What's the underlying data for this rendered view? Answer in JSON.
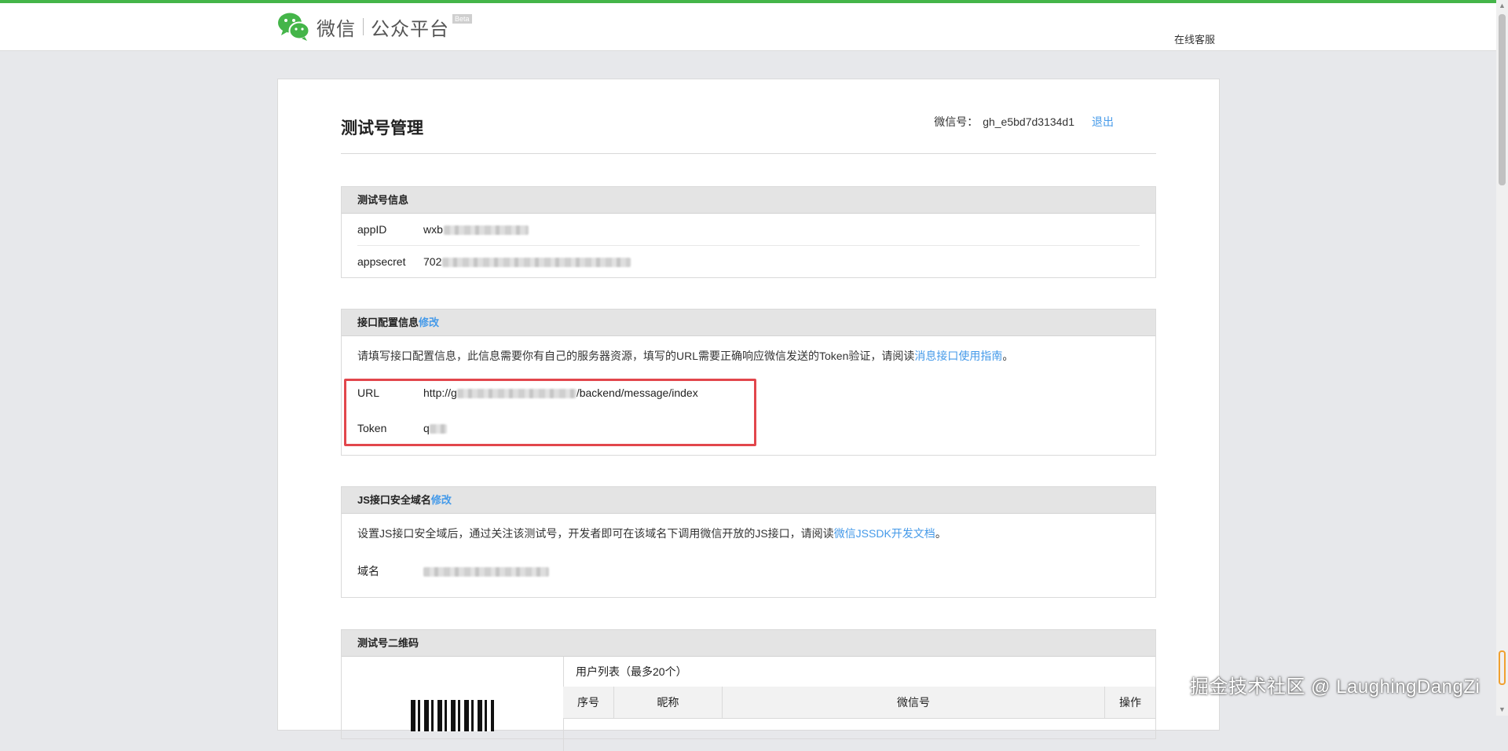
{
  "colors": {
    "accent_green": "#44b549",
    "link_blue": "#459ae9",
    "highlight_red": "#e2464c"
  },
  "header": {
    "logo_icon": "wechat-logo-icon",
    "brand": "微信",
    "platform": "公众平台",
    "beta": "Beta",
    "service_link": "在线客服"
  },
  "page": {
    "title": "测试号管理",
    "account_label": "微信号：",
    "account_id": "gh_e5bd7d3134d1",
    "logout": "退出"
  },
  "test_info": {
    "heading": "测试号信息",
    "appid_label": "appID",
    "appid_value": "wxb",
    "appsecret_label": "appsecret",
    "appsecret_value": "702"
  },
  "api_config": {
    "heading": "接口配置信息",
    "edit": "修改",
    "desc": "请填写接口配置信息，此信息需要你有自己的服务器资源，填写的URL需要正确响应微信发送的Token验证，请阅读",
    "desc_link": "消息接口使用指南",
    "desc_end": "。",
    "url_label": "URL",
    "url_prefix": "http://g",
    "url_suffix": "/backend/message/index",
    "token_label": "Token",
    "token_value": "q"
  },
  "js_domain": {
    "heading": "JS接口安全域名",
    "edit": "修改",
    "desc": "设置JS接口安全域后，通过关注该测试号，开发者即可在该域名下调用微信开放的JS接口，请阅读",
    "desc_link": "微信JSSDK开发文档",
    "desc_end": "。",
    "domain_label": "域名"
  },
  "qrcode": {
    "heading": "测试号二维码",
    "user_list_title": "用户列表（最多20个）",
    "columns": [
      "序号",
      "昵称",
      "微信号",
      "操作"
    ]
  },
  "watermark": "掘金技术社区 @ LaughingDangZi"
}
